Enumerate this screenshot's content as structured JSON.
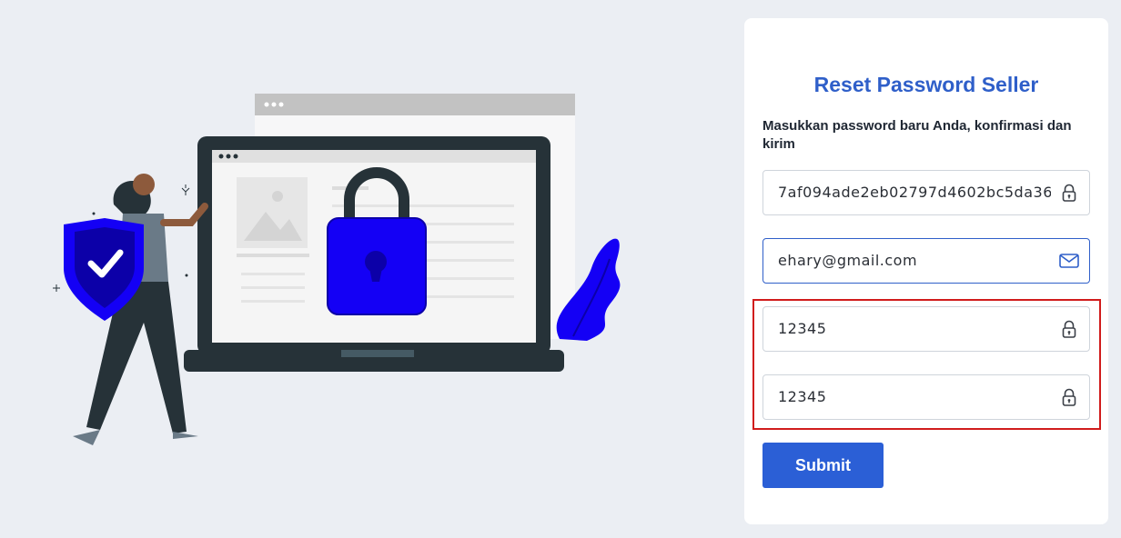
{
  "form": {
    "title": "Reset Password Seller",
    "instruction": "Masukkan password baru Anda, konfirmasi dan kirim",
    "fields": [
      {
        "value": "7af094ade2eb02797d4602bc5da36",
        "icon": "lock-icon"
      },
      {
        "value": "ehary@gmail.com",
        "icon": "envelope-icon"
      },
      {
        "value": "12345",
        "icon": "lock-icon"
      },
      {
        "value": "12345",
        "icon": "lock-icon"
      }
    ],
    "submit_label": "Submit"
  },
  "colors": {
    "background": "#ebeef3",
    "title": "#2f5fc9",
    "submit": "#2b5fd6",
    "highlight": "#d11c1c",
    "lock_blue": "#1400f5"
  },
  "illustration": {
    "subject": "security-lock-laptop-illustration"
  }
}
